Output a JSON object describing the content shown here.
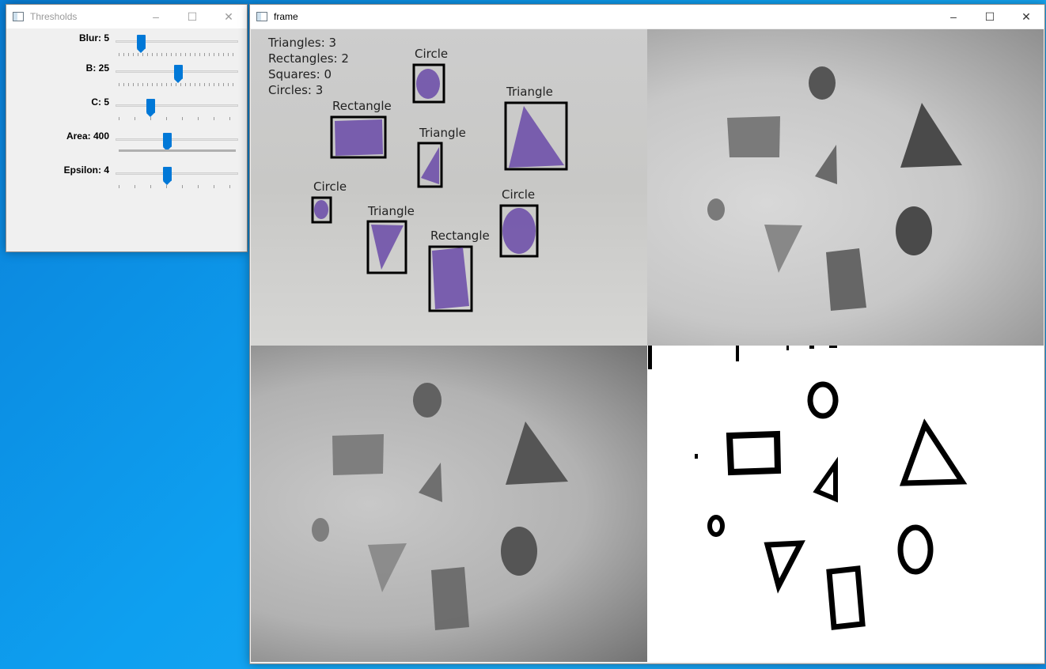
{
  "thresholds_window": {
    "title": "Thresholds",
    "controls": {
      "minimize": "–",
      "maximize": "☐",
      "close": "✕"
    },
    "sliders": [
      {
        "label": "Blur: 5",
        "level": 0.19
      },
      {
        "label": "B: 25",
        "level": 0.51
      },
      {
        "label": "C: 5",
        "level": 0.27
      },
      {
        "label": "Area: 400",
        "level": 0.41
      },
      {
        "label": "Epsilon: 4",
        "level": 0.41
      }
    ]
  },
  "frame_window": {
    "title": "frame",
    "controls": {
      "minimize": "–",
      "maximize": "☐",
      "close": "✕"
    },
    "counts": {
      "triangles": "Triangles: 3",
      "rectangles": "Rectangles: 2",
      "squares": "Squares: 0",
      "circles": "Circles: 3"
    },
    "shape_labels": {
      "circle": "Circle",
      "rectangle": "Rectangle",
      "triangle": "Triangle"
    },
    "colors": {
      "shape_fill": "#6a4aa8",
      "box_stroke": "#000000"
    }
  }
}
